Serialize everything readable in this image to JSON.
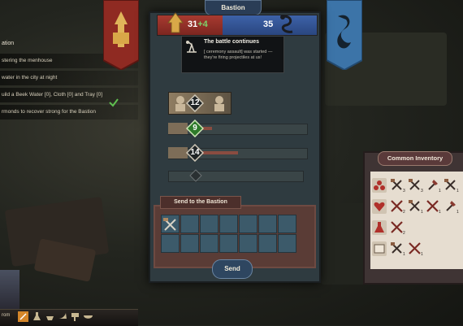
{
  "quest_log": {
    "title": "ation",
    "items": [
      "stering the menhouse",
      "water in the city at night",
      "uild a Beek Water [0], Cloth [0] and Tray [0]",
      "rmonds to recover strong for the Bastion"
    ]
  },
  "header": {
    "tab_title": "Bastion"
  },
  "score": {
    "left_value": "31",
    "left_bonus": "+4",
    "right_value": "35",
    "left_color": "#a83a30",
    "right_color": "#3d62a8"
  },
  "tooltip": {
    "title": "The battle continues",
    "description": "[ ceremony assault] was started — they're firing projectiles at us!"
  },
  "stats": {
    "row1_value": "12",
    "row2_value": "9",
    "row3_value": "14",
    "row2_progress": 0.1,
    "row3_progress": 0.35
  },
  "send_panel": {
    "title": "Send to the Bastion",
    "send_label": "Send"
  },
  "inventory": {
    "title": "Common Inventory",
    "rows": [
      {
        "icon": "blood-drops-icon",
        "items": [
          {
            "icon": "crossbow-icon",
            "qty": "3"
          },
          {
            "icon": "crossbow-icon",
            "qty": "3"
          },
          {
            "icon": "axe-icon",
            "qty": "1"
          },
          {
            "icon": "crossbow-icon",
            "qty": "1"
          }
        ]
      },
      {
        "icon": "heart-potion-icon",
        "items": [
          {
            "icon": "crossed-blades-icon",
            "qty": "2"
          },
          {
            "icon": "crossbow-icon",
            "qty": "1"
          },
          {
            "icon": "crossed-blades-icon",
            "qty": "1"
          },
          {
            "icon": "axe-icon",
            "qty": "1"
          }
        ]
      },
      {
        "icon": "flask-icon",
        "items": [
          {
            "icon": "crossed-blades-icon",
            "qty": "2"
          }
        ]
      },
      {
        "icon": "scroll-icon",
        "items": [
          {
            "icon": "crossbow-icon",
            "qty": "1"
          },
          {
            "icon": "crossed-blades-icon",
            "qty": "1"
          }
        ]
      }
    ]
  },
  "hud": {
    "name": "rom"
  }
}
